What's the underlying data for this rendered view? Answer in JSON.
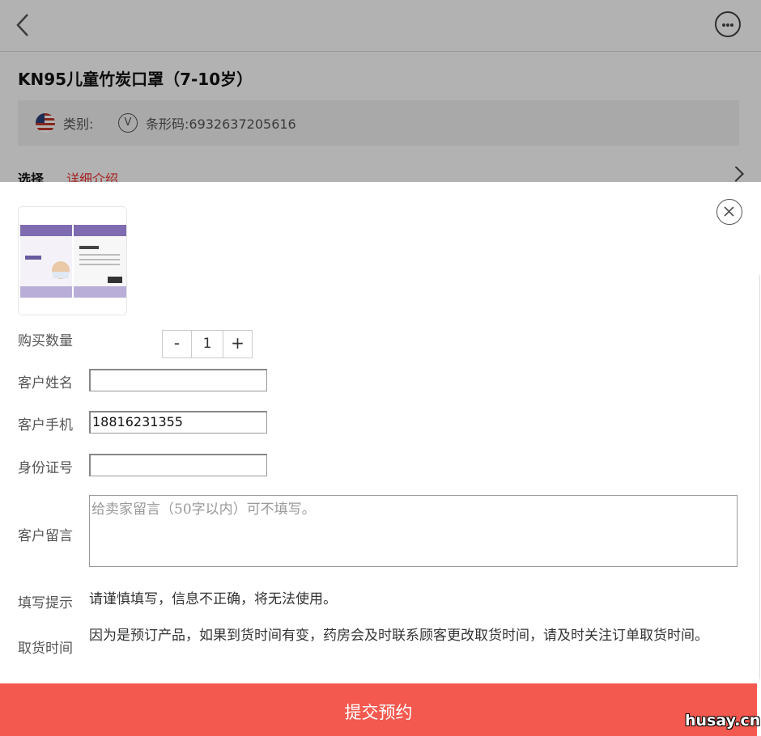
{
  "background_page": {
    "product_title": "KN95儿童竹炭口罩（7-10岁）",
    "category_label": "类别:",
    "barcode_label": "条形码:6932637205616",
    "tab_select": "选择",
    "tab_detail": "详细介绍"
  },
  "modal": {
    "quantity_label": "购买数量",
    "quantity_minus": "-",
    "quantity_value": "1",
    "quantity_plus": "+",
    "name_label": "客户姓名",
    "name_value": "",
    "phone_label": "客户手机",
    "phone_value": "18816231355",
    "id_label": "身份证号",
    "id_value": "",
    "message_label": "客户留言",
    "message_placeholder": "给卖家留言（50字以内）可不填写。",
    "hint_label": "填写提示",
    "hint_text": "请谨慎填写，信息不正确，将无法使用。",
    "pickup_label": "取货时间",
    "pickup_text": "因为是预订产品，如果到货时间有变，药房会及时联系顾客更改取货时间，请及时关注订单取货时间。",
    "submit_label": "提交预约"
  },
  "watermark": "husay.cn",
  "colors": {
    "submit_bg": "#f4594f",
    "detail_tab": "#e33333",
    "overlay": "rgba(0,0,0,0.3)"
  },
  "icons": {
    "back": "chevron-left-icon",
    "more": "more-dots-icon",
    "flag": "us-flag-icon",
    "verify": "v-badge-icon",
    "close": "close-icon",
    "row_arrow": "chevron-right-icon"
  }
}
